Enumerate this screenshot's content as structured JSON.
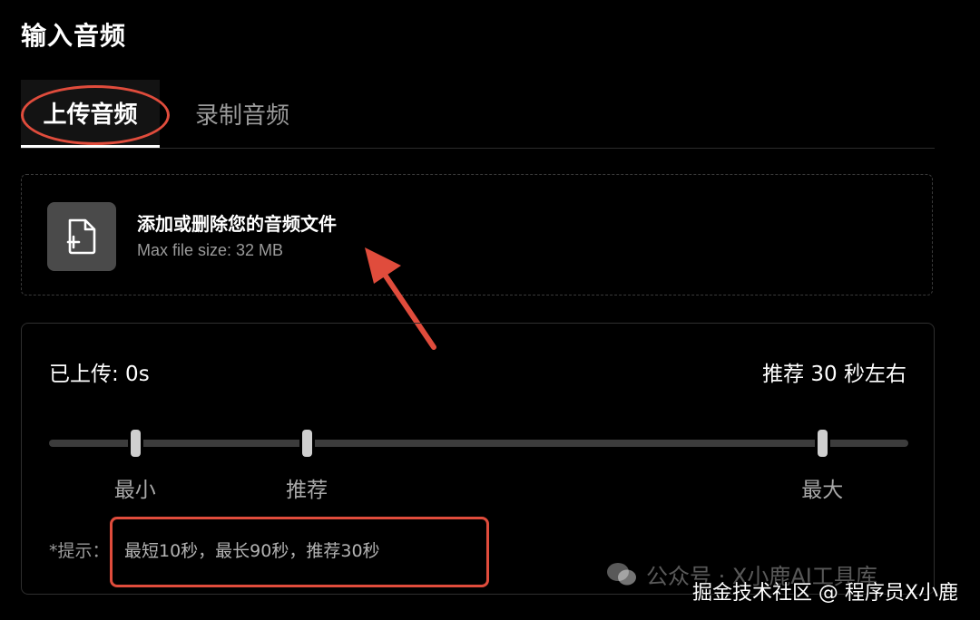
{
  "section_title": "输入音频",
  "tabs": [
    {
      "label": "上传音频",
      "active": true
    },
    {
      "label": "录制音频",
      "active": false
    }
  ],
  "dropzone": {
    "title": "添加或删除您的音频文件",
    "subtitle": "Max file size: 32 MB",
    "icon": "file-add-icon"
  },
  "duration_panel": {
    "uploaded_label": "已上传: 0s",
    "recommend_label": "推荐 30 秒左右",
    "slider": {
      "min_seconds": 10,
      "recommended_seconds": 30,
      "max_seconds": 90,
      "labels": {
        "min": "最小",
        "recommended": "推荐",
        "max": "最大"
      }
    },
    "hint_prefix": "*提示：",
    "hint_text": "最短10秒，最长90秒，推荐30秒"
  },
  "watermark": {
    "faint": "公众号 · X小鹿AI工具库",
    "main": "掘金技术社区 @ 程序员X小鹿"
  },
  "colors": {
    "background": "#000000",
    "annotation_red": "#e04c3c",
    "muted_text": "#9a9a9a"
  }
}
